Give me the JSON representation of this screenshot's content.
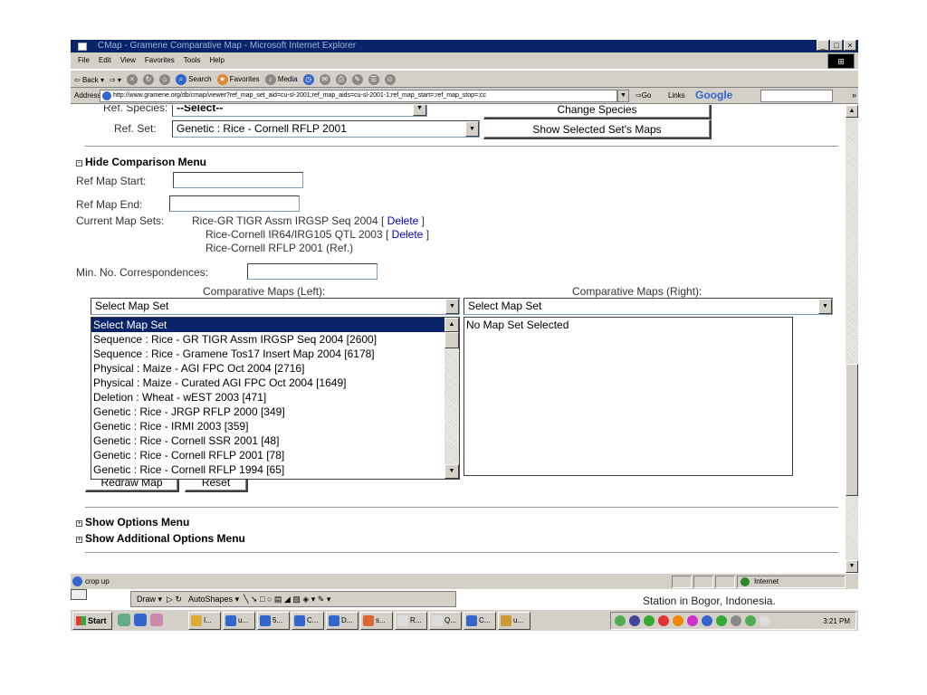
{
  "window": {
    "title": "CMap - Gramene Comparative Map - Microsoft Internet Explorer"
  },
  "menubar": [
    "File",
    "Edit",
    "View",
    "Favorites",
    "Tools",
    "Help"
  ],
  "toolbar": {
    "back": "Back",
    "search": "Search",
    "favorites": "Favorites",
    "media": "Media"
  },
  "address": {
    "label": "Address",
    "url": "http://www.gramene.org/db/cmap/viewer?ref_map_set_aid=cu-sl-2001;ref_map_aids=cu-sl-2001-1;ref_map_start=;ref_map_stop=;cc",
    "go": "Go",
    "links": "Links",
    "google": "Google",
    "more": "»"
  },
  "form": {
    "ref_species_label": "Ref. Species:",
    "ref_species_value": "--Select--",
    "change_species": "Change Species",
    "ref_set_label": "Ref. Set:",
    "ref_set_value": "Genetic : Rice - Cornell RFLP 2001",
    "show_selected": "Show Selected Set's Maps",
    "hide_comparison": "Hide Comparison Menu",
    "ref_map_start_label": "Ref Map Start:",
    "ref_map_end_label": "Ref Map End:",
    "current_map_sets_label": "Current Map Sets:",
    "current_sets": [
      {
        "name": "Rice-GR TIGR Assm IRGSP Seq 2004",
        "delete": "Delete"
      },
      {
        "name": "Rice-Cornell IR64/IRG105 QTL 2003",
        "delete": "Delete"
      },
      {
        "name": "Rice-Cornell RFLP 2001 (Ref.)",
        "delete": ""
      }
    ],
    "min_corr_label": "Min. No. Correspondences:",
    "comp_left_label": "Comparative Maps (Left):",
    "comp_right_label": "Comparative Maps (Right):",
    "left_select": "Select Map Set",
    "right_select": "Select Map Set",
    "left_options": [
      "Select Map Set",
      "Sequence : Rice - GR TIGR Assm IRGSP Seq 2004 [2600]",
      "Sequence : Rice - Gramene Tos17 Insert Map 2004 [6178]",
      "Physical : Maize - AGI FPC Oct 2004 [2716]",
      "Physical : Maize - Curated AGI FPC Oct 2004 [1649]",
      "Deletion : Wheat - wEST 2003 [471]",
      "Genetic : Rice - JRGP RFLP 2000 [349]",
      "Genetic : Rice - IRMI 2003 [359]",
      "Genetic : Rice - Cornell SSR 2001 [48]",
      "Genetic : Rice - Cornell RFLP 2001 [78]",
      "Genetic : Rice - Cornell RFLP 1994 [65]"
    ],
    "right_list_empty": "No Map Set Selected",
    "redraw": "Redraw Map",
    "reset": "Reset",
    "show_options": "Show Options Menu",
    "show_additional": "Show Additional Options Menu"
  },
  "status": {
    "text": "crop up",
    "zone": "Internet"
  },
  "behind": {
    "draw": "Draw",
    "autoshapes": "AutoShapes",
    "station": "Station in Bogor, Indonesia."
  },
  "taskbar": {
    "start": "Start",
    "tasks": [
      "I...",
      "u...",
      "5...",
      "C...",
      "D...",
      "s...",
      "R...",
      "Q...",
      "C...",
      "u..."
    ],
    "clock": "3:21 PM"
  },
  "colors": {
    "selection": "#0a246a",
    "link": "#0000cc",
    "chrome": "#d4d0c8"
  }
}
